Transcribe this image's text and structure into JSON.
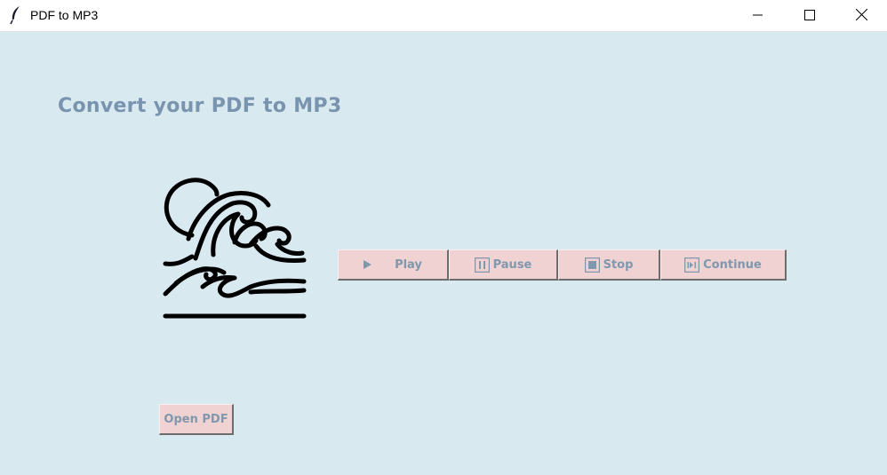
{
  "window": {
    "title": "PDF to MP3",
    "app_icon": "feather-icon",
    "controls": [
      "minimize-icon",
      "maximize-icon",
      "close-icon"
    ]
  },
  "main": {
    "heading": "Convert your PDF to MP3",
    "logo_icon": "ocean-wave-icon"
  },
  "playback": {
    "play_label": "Play",
    "pause_label": "Pause",
    "stop_label": "Stop",
    "continue_label": "Continue",
    "icons": [
      "play-icon",
      "pause-icon",
      "stop-icon",
      "continue-icon"
    ]
  },
  "file": {
    "open_label": "Open PDF"
  },
  "colors": {
    "background": "#d9e9f0",
    "button_bg": "#f0d2d3",
    "text_accent": "#7894ae"
  }
}
